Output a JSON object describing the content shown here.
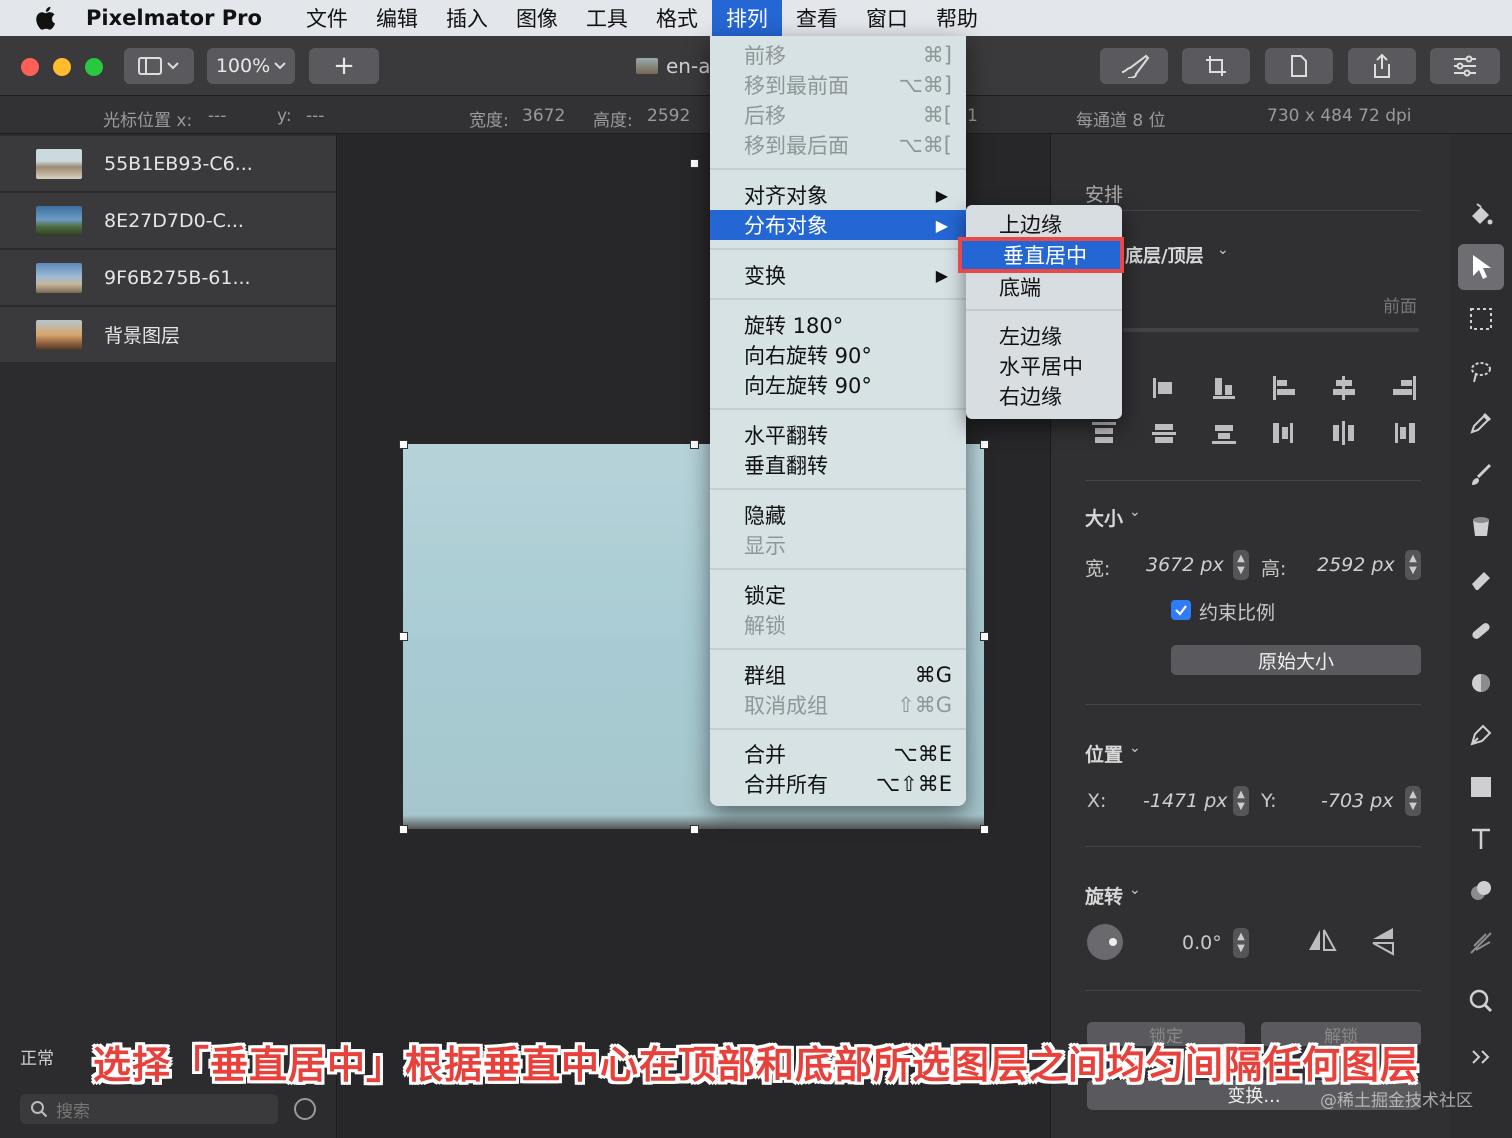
{
  "menubar": {
    "app_name": "Pixelmator Pro",
    "items": [
      "文件",
      "编辑",
      "插入",
      "图像",
      "工具",
      "格式",
      "排列",
      "查看",
      "窗口",
      "帮助"
    ],
    "active_index": 6
  },
  "toolbar": {
    "zoom": "100%",
    "add_label": "+",
    "document_title": "en-a"
  },
  "infobar": {
    "cursor_x_label": "光标位置 x:",
    "cursor_x_value": "---",
    "cursor_y_label": "y:",
    "cursor_y_value": "---",
    "width_label": "宽度:",
    "width_value": "3672",
    "height_label": "高度:",
    "height_value": "2592",
    "partial": "1",
    "bit_depth": "每通道 8 位",
    "resolution": "730 x 484 72 dpi"
  },
  "layers": [
    {
      "name": "55B1EB93-C6..."
    },
    {
      "name": "8E27D7D0-C..."
    },
    {
      "name": "9F6B275B-61..."
    },
    {
      "name": "背景图层"
    }
  ],
  "sidebar": {
    "blend_mode": "正常",
    "search_placeholder": "搜索"
  },
  "arrange_menu": {
    "items": [
      {
        "label": "前移",
        "shortcut": "⌘]",
        "disabled": true
      },
      {
        "label": "移到最前面",
        "shortcut": "⌥⌘]",
        "disabled": true
      },
      {
        "label": "后移",
        "shortcut": "⌘[",
        "disabled": true
      },
      {
        "label": "移到最后面",
        "shortcut": "⌥⌘[",
        "disabled": true
      },
      {
        "label": "对齐对象",
        "submenu": true
      },
      {
        "label": "分布对象",
        "submenu": true,
        "highlighted": true
      },
      {
        "label": "变换",
        "submenu": true
      },
      {
        "label": "旋转 180°"
      },
      {
        "label": "向右旋转 90°"
      },
      {
        "label": "向左旋转 90°"
      },
      {
        "label": "水平翻转"
      },
      {
        "label": "垂直翻转"
      },
      {
        "label": "隐藏"
      },
      {
        "label": "显示",
        "disabled": true
      },
      {
        "label": "锁定"
      },
      {
        "label": "解锁",
        "disabled": true
      },
      {
        "label": "群组",
        "shortcut": "⌘G"
      },
      {
        "label": "取消成组",
        "shortcut": "⇧⌘G",
        "disabled": true
      },
      {
        "label": "合并",
        "shortcut": "⌥⌘E"
      },
      {
        "label": "合并所有",
        "shortcut": "⌥⇧⌘E"
      }
    ]
  },
  "distribute_submenu": {
    "items": [
      {
        "label": "上边缘"
      },
      {
        "label": "垂直居中",
        "highlighted": true
      },
      {
        "label": "底端"
      },
      {
        "label": "左边缘"
      },
      {
        "label": "水平居中"
      },
      {
        "label": "右边缘"
      }
    ]
  },
  "inspector": {
    "arrange_title": "安排",
    "order_dropdown": "底层/顶层",
    "front_label": "前面",
    "size_title": "大小",
    "width_label": "宽:",
    "width_value": "3672 px",
    "height_label": "高:",
    "height_value": "2592 px",
    "constrain_label": "约束比例",
    "original_size_button": "原始大小",
    "position_title": "位置",
    "x_label": "X:",
    "x_value": "-1471 px",
    "y_label": "Y:",
    "y_value": "-703 px",
    "rotation_title": "旋转",
    "rotation_value": "0.0°",
    "lock_button": "锁定",
    "unlock_button": "解锁",
    "transform_button": "变换..."
  },
  "caption": "选择「垂直居中」根据垂直中心在顶部和底部所选图层之间均匀间隔任何图层",
  "watermark": "@稀土掘金技术社区",
  "colors": {
    "menu_highlight": "#2466d4",
    "callout_border": "#e84848",
    "caption_text": "#e8403a"
  }
}
